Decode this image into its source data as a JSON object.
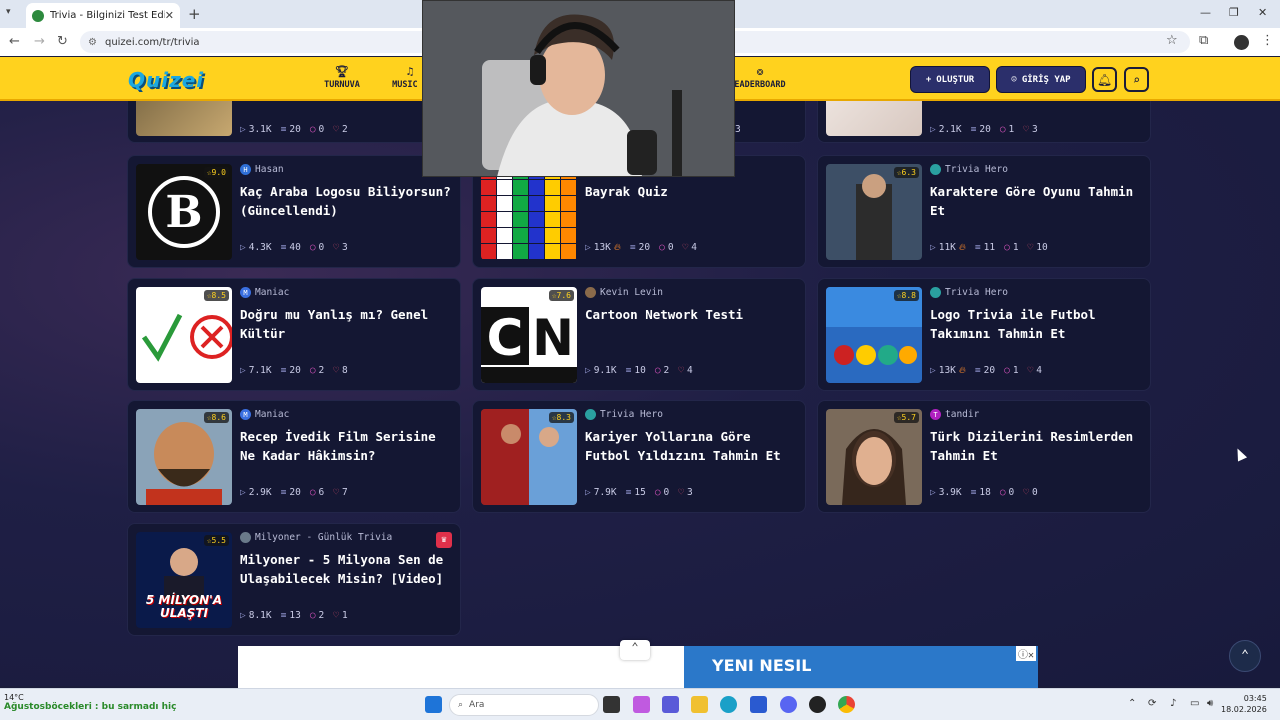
{
  "browser": {
    "tab_title": "Trivia - Bilginizi Test Edin - Quiz",
    "url": "quizei.com/tr/trivia"
  },
  "header": {
    "logo": "Quizei",
    "nav": [
      {
        "label": "TURNUVA",
        "icon": "trophy-icon"
      },
      {
        "label": "MUSIC Q",
        "icon": "music-icon"
      },
      {
        "label": "EADERBOARD",
        "icon": "medal-icon"
      }
    ],
    "create_label": "OLUŞTUR",
    "login_label": "GİRİŞ YAP"
  },
  "top_row": [
    {
      "plays": "3.1K",
      "questions": "20",
      "comments": "0",
      "likes": "2"
    },
    {
      "questions": "3"
    },
    {
      "plays": "2.1K",
      "questions": "20",
      "comments": "1",
      "likes": "3"
    }
  ],
  "cards": [
    {
      "rating": "9.0",
      "author": "Hasan",
      "author_initial": "H",
      "author_color": "#2f6fd6",
      "title": "Kaç Araba Logosu Biliyorsun? (Güncellendi)",
      "plays": "4.3K",
      "hot": false,
      "questions": "40",
      "comments": "0",
      "likes": "3",
      "thumb": "b-logo"
    },
    {
      "rating": "",
      "author": "",
      "author_initial": "",
      "author_color": "#2f6fd6",
      "title": "Bayrak Quiz",
      "plays": "13K",
      "hot": true,
      "questions": "20",
      "comments": "0",
      "likes": "4",
      "thumb": "flags"
    },
    {
      "rating": "6.3",
      "author": "Trivia Hero",
      "author_initial": "",
      "author_color": "#2aa0a0",
      "title": "Karaktere Göre Oyunu Tahmin Et",
      "plays": "11K",
      "hot": true,
      "questions": "11",
      "comments": "1",
      "likes": "10",
      "thumb": "game"
    },
    {
      "rating": "8.5",
      "author": "Maniac",
      "author_initial": "M",
      "author_color": "#3a6fe0",
      "title": "Doğru mu Yanlış mı? Genel Kültür",
      "plays": "7.1K",
      "hot": false,
      "questions": "20",
      "comments": "2",
      "likes": "8",
      "thumb": "checkx"
    },
    {
      "rating": "7.6",
      "author": "Kevin Levin",
      "author_initial": "",
      "author_color": "#8a6a4a",
      "title": "Cartoon Network Testi",
      "plays": "9.1K",
      "hot": false,
      "questions": "10",
      "comments": "2",
      "likes": "4",
      "thumb": "cn"
    },
    {
      "rating": "8.8",
      "author": "Trivia Hero",
      "author_initial": "",
      "author_color": "#2aa0a0",
      "title": "Logo Trivia ile Futbol Takımını Tahmin Et",
      "plays": "13K",
      "hot": true,
      "questions": "20",
      "comments": "1",
      "likes": "4",
      "thumb": "football"
    },
    {
      "rating": "8.6",
      "author": "Maniac",
      "author_initial": "M",
      "author_color": "#3a6fe0",
      "title": "Recep İvedik Film Serisine Ne Kadar Hâkimsin?",
      "plays": "2.9K",
      "hot": false,
      "questions": "20",
      "comments": "6",
      "likes": "7",
      "thumb": "recep"
    },
    {
      "rating": "8.3",
      "author": "Trivia Hero",
      "author_initial": "",
      "author_color": "#2aa0a0",
      "title": "Kariyer Yollarına Göre Futbol Yıldızını Tahmin Et",
      "plays": "7.9K",
      "hot": false,
      "questions": "15",
      "comments": "0",
      "likes": "3",
      "thumb": "players"
    },
    {
      "rating": "5.7",
      "author": "tandir",
      "author_initial": "T",
      "author_color": "#b020c0",
      "title": "Türk Dizilerini Resimlerden Tahmin Et",
      "plays": "3.9K",
      "hot": false,
      "questions": "18",
      "comments": "0",
      "likes": "0",
      "thumb": "woman"
    },
    {
      "rating": "5.5",
      "author": "Milyoner - Günlük Trivia",
      "author_initial": "",
      "author_color": "#6a7a8a",
      "title": "Milyoner - 5 Milyona Sen de Ulaşabilecek Misin? [Video]",
      "plays": "8.1K",
      "hot": false,
      "questions": "13",
      "comments": "2",
      "likes": "1",
      "thumb": "milyoner",
      "thumb_text": "5 MİLYON'A ULAŞTI"
    }
  ],
  "ad": {
    "text": "YENI NESIL"
  },
  "taskbar": {
    "weather_temp": "14°C",
    "weather_text": "Ağustosböcekleri : bu sarmadı hiç",
    "search": "Ara",
    "time": "03:45",
    "date": "18.02.2026"
  }
}
